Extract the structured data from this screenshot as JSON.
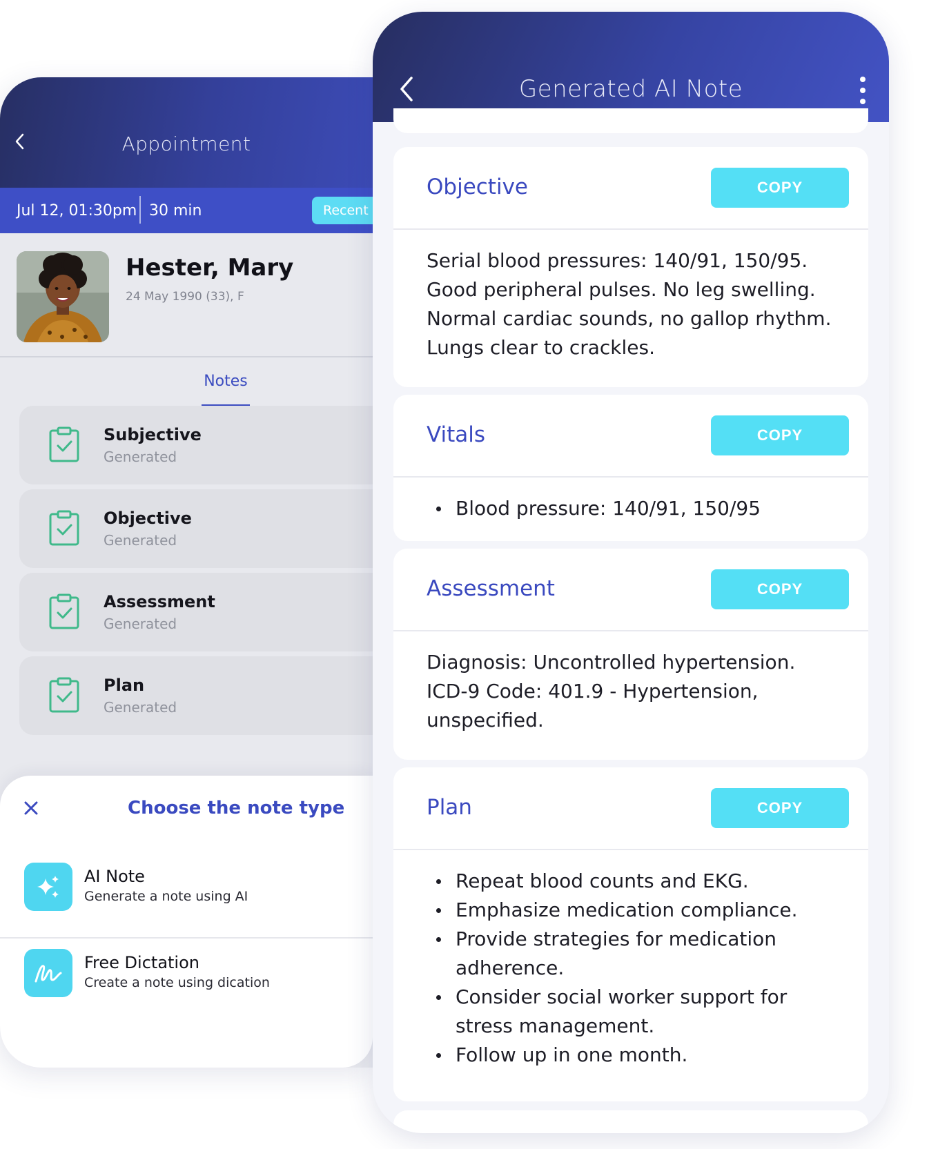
{
  "appointment_screen": {
    "title": "Appointment",
    "date_time": "Jul 12, 01:30pm",
    "duration": "30 min",
    "recent_badge": "Recent",
    "patient": {
      "name": "Hester, Mary",
      "meta": "24 May 1990 (33), F"
    },
    "active_tab": "Notes",
    "notes": [
      {
        "title": "Subjective",
        "status": "Generated"
      },
      {
        "title": "Objective",
        "status": "Generated"
      },
      {
        "title": "Assessment",
        "status": "Generated"
      },
      {
        "title": "Plan",
        "status": "Generated"
      }
    ],
    "sheet": {
      "title": "Choose the note type",
      "options": [
        {
          "title": "AI Note",
          "description": "Generate a note using AI",
          "icon": "sparkle-icon"
        },
        {
          "title": "Free Dictation",
          "description": "Create a note using dication",
          "icon": "handwriting-icon"
        }
      ]
    }
  },
  "ai_note_screen": {
    "title": "Generated AI Note",
    "copy_label": "COPY",
    "sections": [
      {
        "title": "Objective",
        "lines": [
          "Serial blood pressures: 140/91, 150/95.",
          "Good peripheral pulses. No leg swelling.",
          "Normal cardiac sounds, no gallop rhythm.",
          "Lungs clear to crackles."
        ]
      },
      {
        "title": "Vitals",
        "bullets": [
          "Blood pressure: 140/91, 150/95"
        ]
      },
      {
        "title": "Assessment",
        "lines": [
          "Diagnosis: Uncontrolled hypertension.",
          "ICD-9 Code: 401.9 - Hypertension,",
          "unspecified."
        ]
      },
      {
        "title": "Plan",
        "bullets": [
          "Repeat blood counts and EKG.",
          "Emphasize medication compliance.",
          "Provide strategies for medication adherence.",
          "Consider social worker support for stress management.",
          "Follow up in one month."
        ]
      }
    ]
  },
  "colors": {
    "header_dark": "#272e60",
    "header_light": "#4353c4",
    "accent_blue": "#3a49bf",
    "copy_cyan": "#54dff5",
    "icon_green": "#3fb98a"
  }
}
